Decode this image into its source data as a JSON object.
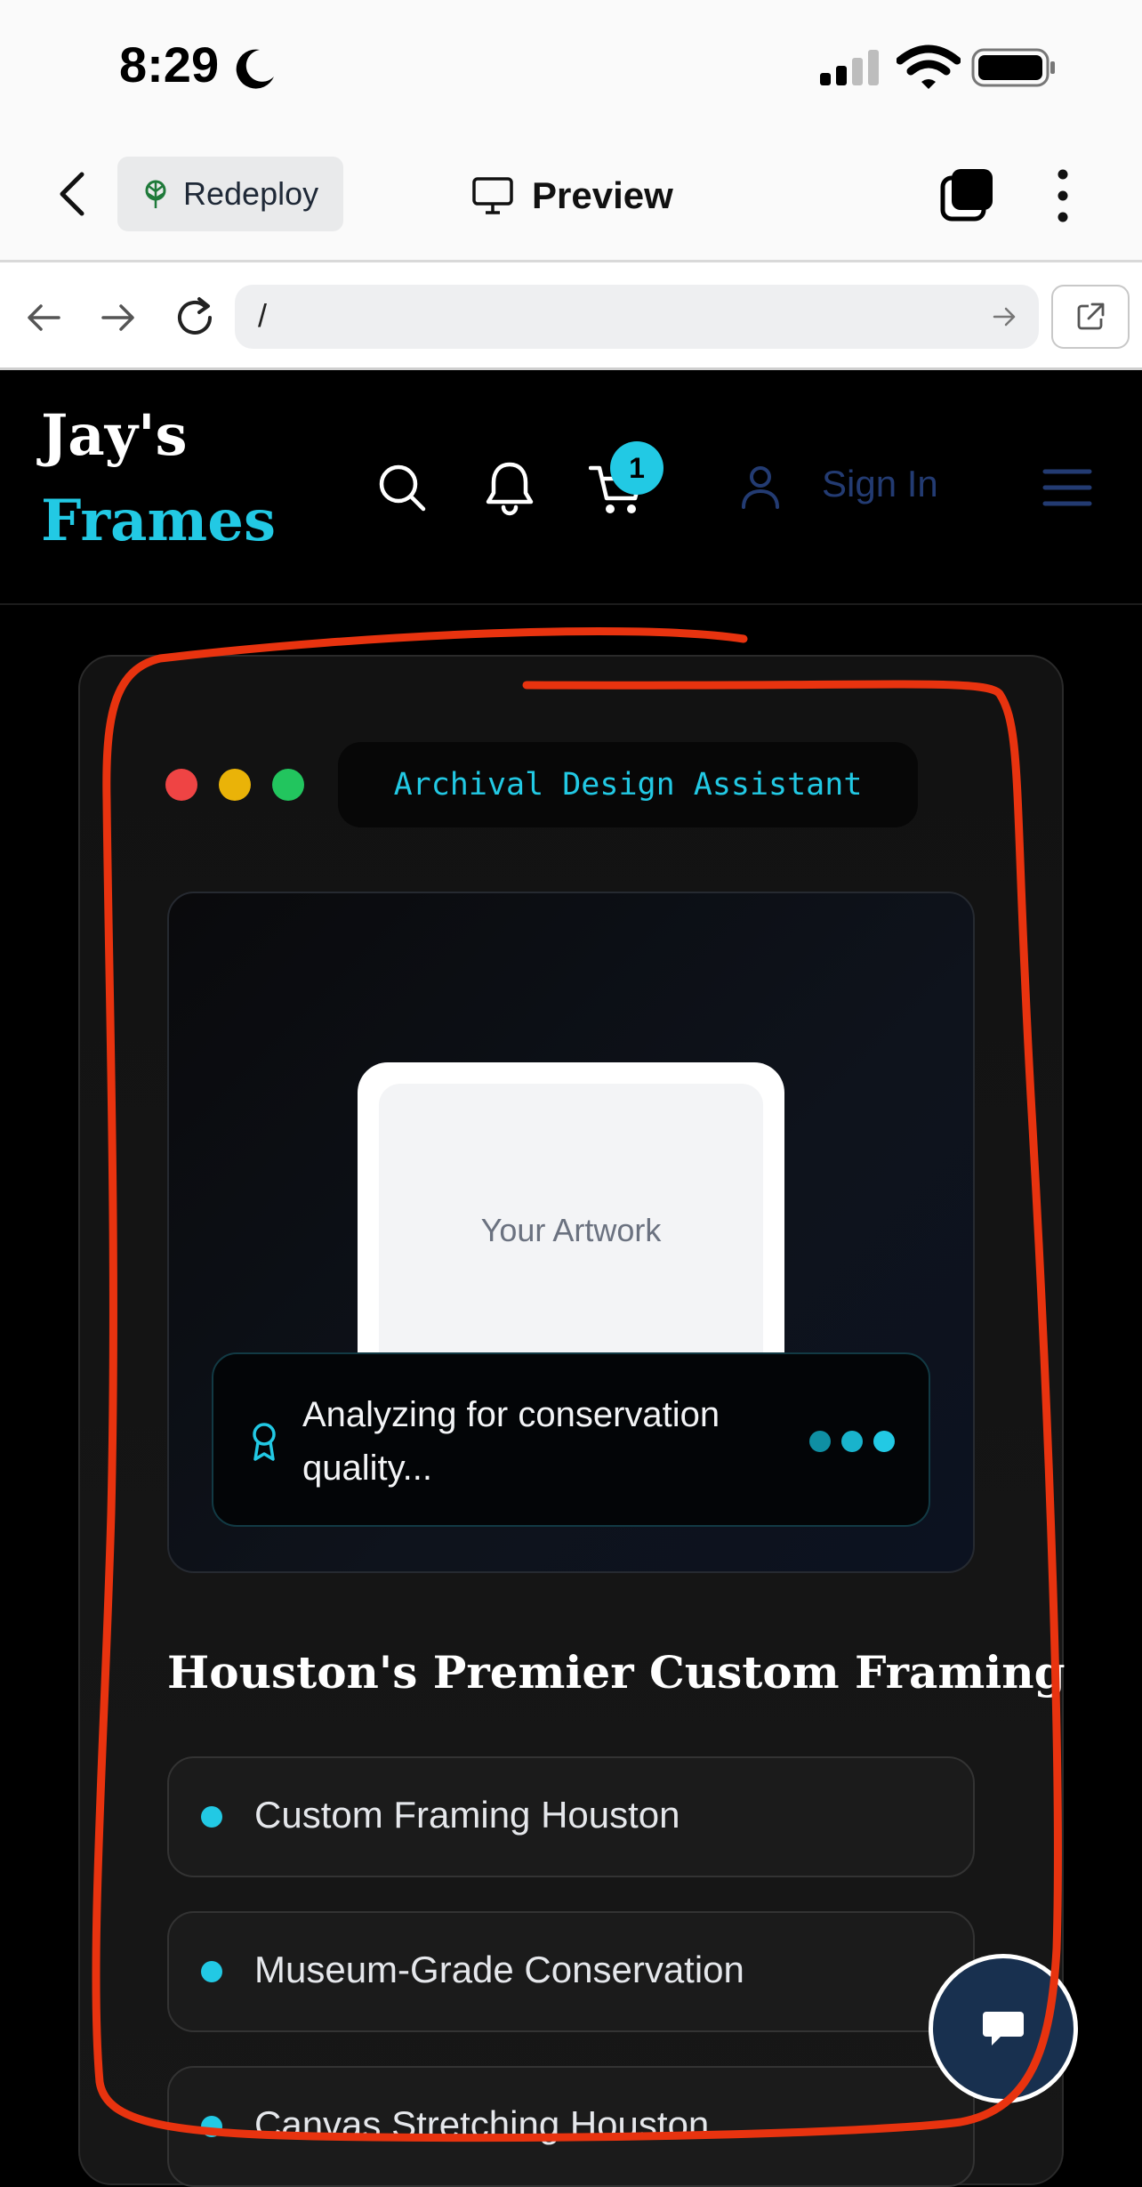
{
  "status_bar": {
    "time": "8:29"
  },
  "browser": {
    "redeploy_label": "Redeploy",
    "preview_label": "Preview",
    "url": "/"
  },
  "site": {
    "logo_line1": "Jay's",
    "logo_line2": "Frames",
    "cart_count": "1",
    "signin_label": "Sign In"
  },
  "card": {
    "assistant_label": "Archival Design Assistant",
    "artwork_label": "Your Artwork",
    "analyzing_text": "Analyzing for conservation quality...",
    "section_title": "Houston's Premier Custom Framing",
    "features": [
      "Custom Framing Houston",
      "Museum-Grade Conservation",
      "Canvas Stretching Houston"
    ]
  },
  "colors": {
    "accent": "#22c9e4",
    "signin": "#233b72",
    "annotation": "#e8330f"
  },
  "icons": [
    "moon-icon",
    "signal-icon",
    "wifi-icon",
    "battery-icon",
    "chevron-left-icon",
    "redeploy-icon",
    "monitor-icon",
    "tabs-icon",
    "more-vertical-icon",
    "arrow-left-icon",
    "arrow-right-icon",
    "reload-icon",
    "open-external-icon",
    "search-icon",
    "bell-icon",
    "cart-icon",
    "user-icon",
    "menu-icon",
    "award-icon",
    "chat-icon"
  ]
}
